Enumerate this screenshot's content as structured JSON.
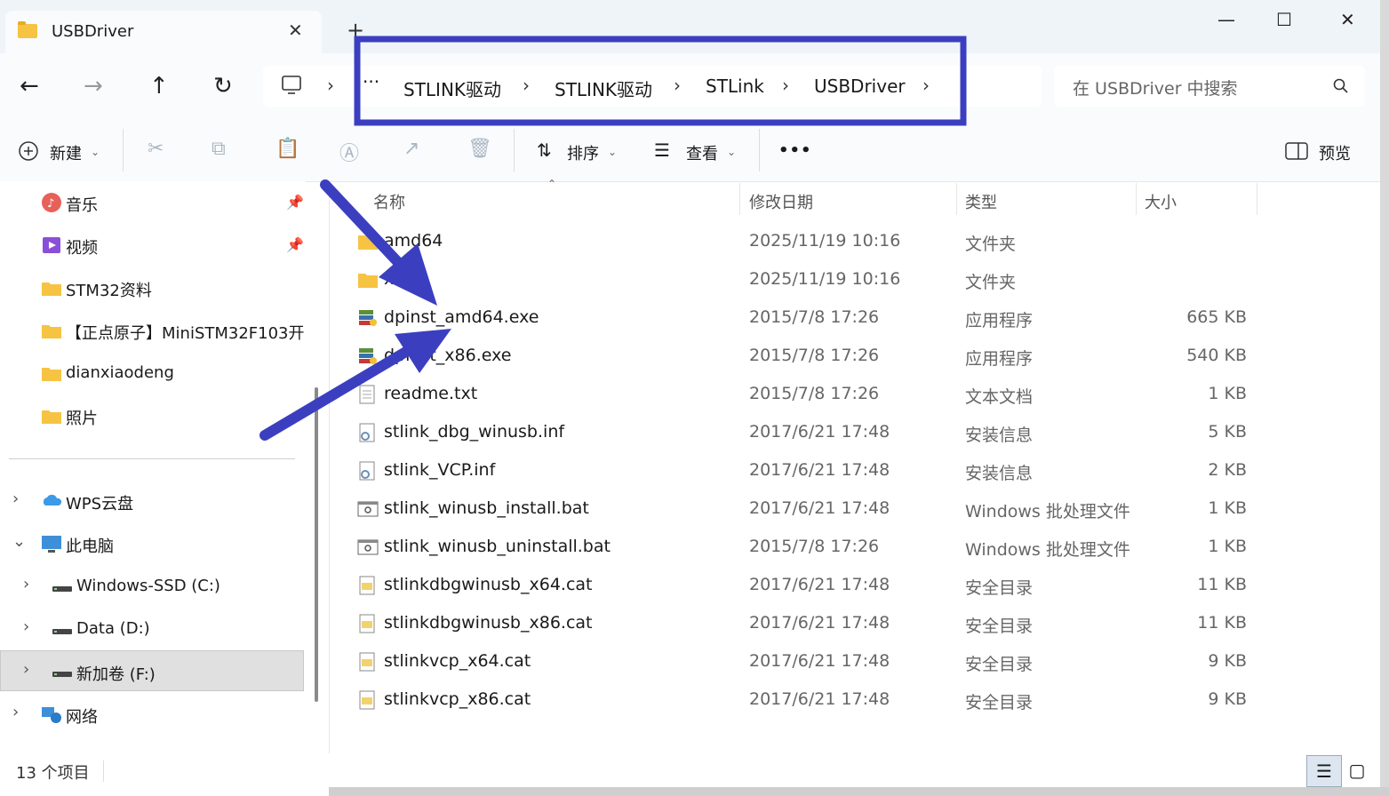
{
  "window": {
    "tab_title": "USBDriver",
    "tab_close": "✕",
    "new_tab": "+",
    "minimize": "—",
    "maximize": "☐",
    "close": "✕"
  },
  "nav": {
    "back": "←",
    "forward": "→",
    "up": "↑",
    "refresh": "↻",
    "breadcrumb": [
      "STLINK驱动",
      "STLINK驱动",
      "STLink",
      "USBDriver"
    ],
    "ellipsis": "···",
    "search_placeholder": "在 USBDriver 中搜索"
  },
  "toolbar": {
    "new_label": "新建",
    "sort_label": "排序",
    "view_label": "查看",
    "more": "•••",
    "preview_label": "预览"
  },
  "sidebar": {
    "quick": [
      {
        "label": "音乐",
        "icon": "music-icon",
        "pinned": true
      },
      {
        "label": "视频",
        "icon": "video-icon",
        "pinned": true
      },
      {
        "label": "STM32资料",
        "icon": "folder-icon"
      },
      {
        "label": "【正点原子】MiniSTM32F103开",
        "icon": "folder-icon"
      },
      {
        "label": "dianxiaodeng",
        "icon": "folder-icon"
      },
      {
        "label": "照片",
        "icon": "folder-icon"
      }
    ],
    "tree": [
      {
        "label": "WPS云盘",
        "icon": "cloud-icon",
        "indent": 0,
        "chev": "›"
      },
      {
        "label": "此电脑",
        "icon": "computer-icon",
        "indent": 0,
        "chev": "⌄"
      },
      {
        "label": "Windows-SSD (C:)",
        "icon": "drive-icon",
        "indent": 1,
        "chev": "›"
      },
      {
        "label": "Data (D:)",
        "icon": "drive-icon",
        "indent": 1,
        "chev": "›"
      },
      {
        "label": "新加卷 (F:)",
        "icon": "drive-icon",
        "indent": 1,
        "chev": "›",
        "selected": true
      },
      {
        "label": "网络",
        "icon": "network-icon",
        "indent": 0,
        "chev": "›"
      }
    ]
  },
  "columns": {
    "name": "名称",
    "date": "修改日期",
    "type": "类型",
    "size": "大小"
  },
  "files": [
    {
      "name": "amd64",
      "date": "2025/11/19 10:16",
      "type": "文件夹",
      "size": "",
      "icon": "folder"
    },
    {
      "name": "x86",
      "date": "2025/11/19 10:16",
      "type": "文件夹",
      "size": "",
      "icon": "folder"
    },
    {
      "name": "dpinst_amd64.exe",
      "date": "2015/7/8 17:26",
      "type": "应用程序",
      "size": "665 KB",
      "icon": "exe"
    },
    {
      "name": "dpinst_x86.exe",
      "date": "2015/7/8 17:26",
      "type": "应用程序",
      "size": "540 KB",
      "icon": "exe"
    },
    {
      "name": "readme.txt",
      "date": "2015/7/8 17:26",
      "type": "文本文档",
      "size": "1 KB",
      "icon": "txt"
    },
    {
      "name": "stlink_dbg_winusb.inf",
      "date": "2017/6/21 17:48",
      "type": "安装信息",
      "size": "5 KB",
      "icon": "inf"
    },
    {
      "name": "stlink_VCP.inf",
      "date": "2017/6/21 17:48",
      "type": "安装信息",
      "size": "2 KB",
      "icon": "inf"
    },
    {
      "name": "stlink_winusb_install.bat",
      "date": "2017/6/21 17:48",
      "type": "Windows 批处理文件",
      "size": "1 KB",
      "icon": "bat"
    },
    {
      "name": "stlink_winusb_uninstall.bat",
      "date": "2015/7/8 17:26",
      "type": "Windows 批处理文件",
      "size": "1 KB",
      "icon": "bat"
    },
    {
      "name": "stlinkdbgwinusb_x64.cat",
      "date": "2017/6/21 17:48",
      "type": "安全目录",
      "size": "11 KB",
      "icon": "cat"
    },
    {
      "name": "stlinkdbgwinusb_x86.cat",
      "date": "2017/6/21 17:48",
      "type": "安全目录",
      "size": "11 KB",
      "icon": "cat"
    },
    {
      "name": "stlinkvcp_x64.cat",
      "date": "2017/6/21 17:48",
      "type": "安全目录",
      "size": "9 KB",
      "icon": "cat"
    },
    {
      "name": "stlinkvcp_x86.cat",
      "date": "2017/6/21 17:48",
      "type": "安全目录",
      "size": "9 KB",
      "icon": "cat"
    }
  ],
  "status": {
    "count": "13 个项目"
  },
  "annotation": {
    "box_color": "#3b3fbf",
    "arrow_color": "#3b3fbf"
  }
}
